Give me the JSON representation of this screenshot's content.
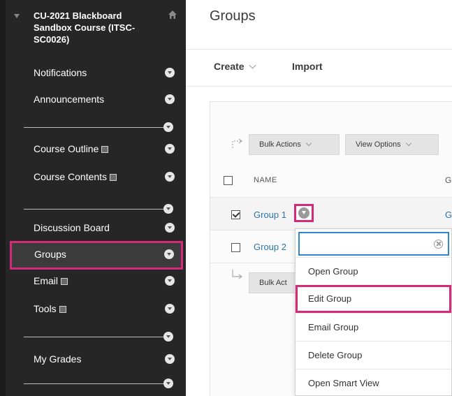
{
  "sidebar": {
    "course_title": "CU-2021 Blackboard Sandbox Course (ITSC-SC0026)",
    "items": [
      {
        "label": "Notifications"
      },
      {
        "label": "Announcements"
      },
      {
        "label": "Course Outline"
      },
      {
        "label": "Course Contents"
      },
      {
        "label": "Discussion Board"
      },
      {
        "label": "Groups"
      },
      {
        "label": "Email"
      },
      {
        "label": "Tools"
      },
      {
        "label": "My Grades"
      }
    ],
    "active_item": "Groups"
  },
  "main": {
    "title": "Groups",
    "actions": {
      "create": "Create",
      "import": "Import"
    },
    "toolbar": {
      "bulk_actions": "Bulk Actions",
      "view_options": "View Options"
    },
    "table": {
      "col_name": "NAME",
      "col_g": "G",
      "rows": [
        {
          "name": "Group 1",
          "checked": true,
          "g": "G"
        },
        {
          "name": "Group 2",
          "checked": false
        }
      ]
    },
    "bottom_toolbar": {
      "bulk_actions": "Bulk Act"
    }
  },
  "context_menu": {
    "search_value": "",
    "items": [
      {
        "label": "Open Group"
      },
      {
        "label": "Edit Group",
        "highlighted": true
      },
      {
        "label": "Email Group"
      },
      {
        "label": "Delete Group"
      },
      {
        "label": "Open Smart View"
      }
    ]
  },
  "colors": {
    "sidebar_bg": "#262626",
    "highlight": "#d32b7a",
    "link": "#2d74a6",
    "focus": "#2d87d3"
  }
}
